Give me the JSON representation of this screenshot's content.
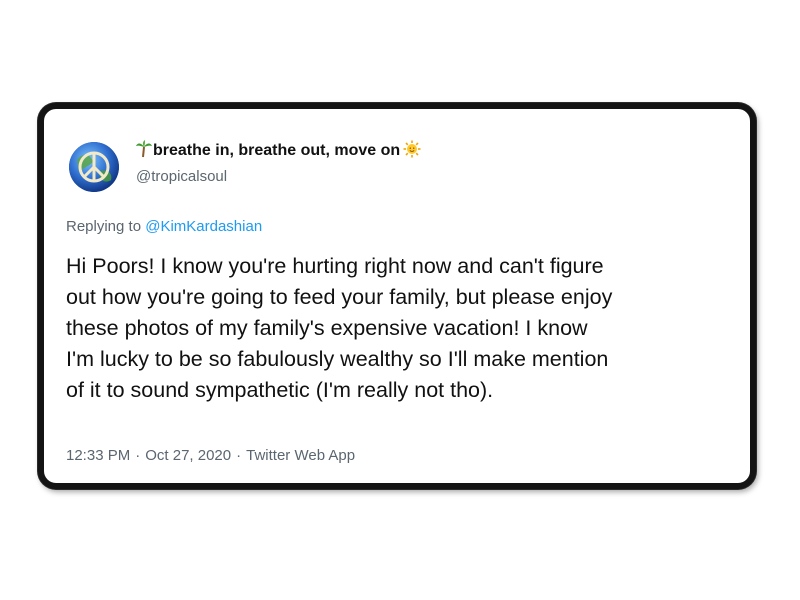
{
  "tweet": {
    "display_name": "breathe in, breathe out, move on",
    "name_prefix_icon": "palm-tree-icon",
    "name_suffix_icon": "sun-icon",
    "handle": "@tropicalsoul",
    "replying_to_label": "Replying to",
    "replying_to_handle": "@KimKardashian",
    "text_lines": [
      "Hi Poors! I know you're hurting right now and can't figure",
      "out how you're going to feed your family, but please enjoy",
      "these photos of my family's expensive vacation! I know",
      "I'm lucky to be so fabulously wealthy so I'll make mention",
      "of it to sound sympathetic (I'm really not tho)."
    ],
    "time": "12:33 PM",
    "date": "Oct 27, 2020",
    "source": "Twitter Web App",
    "separator": "·"
  },
  "colors": {
    "text": "#111111",
    "secondary": "#5b6670",
    "link": "#1d9bf0",
    "frame": "#141414"
  }
}
